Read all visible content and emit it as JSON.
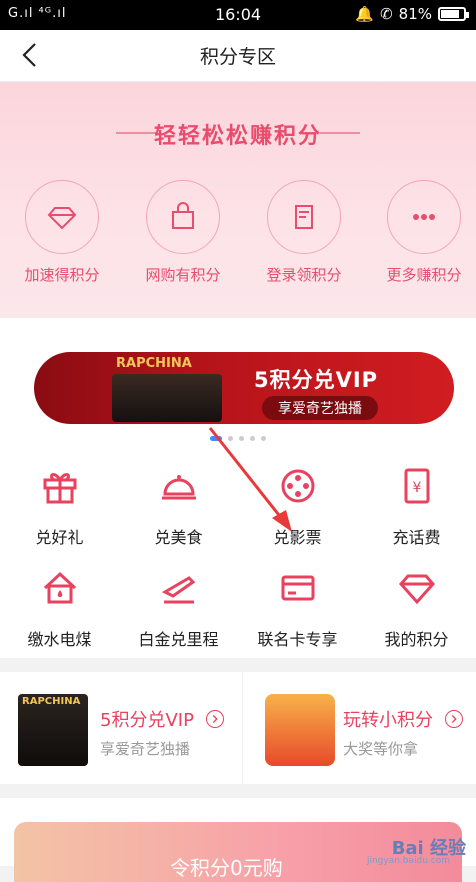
{
  "statusbar": {
    "signal": "G.ıl ⁴ᴳ.ıl",
    "time": "16:04",
    "battery": "81%",
    "battery_level": 0.81
  },
  "navbar": {
    "title": "积分专区"
  },
  "earn": {
    "headline": "轻轻松松赚积分",
    "items": [
      {
        "label": "加速得积分",
        "icon": "diamond-icon"
      },
      {
        "label": "网购有积分",
        "icon": "shopping-bag-icon"
      },
      {
        "label": "登录领积分",
        "icon": "receipt-icon"
      },
      {
        "label": "更多赚积分",
        "icon": "more-dots-icon"
      }
    ]
  },
  "carousel": {
    "brand": "RAPCHINA",
    "promo": "5积分兑VIP",
    "sub": "享爱奇艺独播",
    "page_count": 5,
    "active_index": 0
  },
  "grid": {
    "items": [
      {
        "label": "兑好礼",
        "icon": "gift-icon"
      },
      {
        "label": "兑美食",
        "icon": "food-cover-icon"
      },
      {
        "label": "兑影票",
        "icon": "film-reel-icon"
      },
      {
        "label": "充话费",
        "icon": "phone-yuan-icon"
      },
      {
        "label": "缴水电煤",
        "icon": "house-drop-icon"
      },
      {
        "label": "白金兑里程",
        "icon": "airplane-icon"
      },
      {
        "label": "联名卡专享",
        "icon": "card-icon"
      },
      {
        "label": "我的积分",
        "icon": "diamond-icon"
      }
    ]
  },
  "promos": [
    {
      "title": "5积分兑VIP",
      "sub": "享爱奇艺独播",
      "brand": "RAPCHINA"
    },
    {
      "title": "玩转小积分",
      "sub": "大奖等你拿"
    }
  ],
  "bottom": {
    "text": "令积分0元购",
    "watermark": "Bai 经验",
    "watermark_sub": "jingyan.baidu.com"
  },
  "colors": {
    "accent": "#e8425f",
    "banner_bg": "#fbd5dc",
    "carousel_red": "#b8141b"
  }
}
